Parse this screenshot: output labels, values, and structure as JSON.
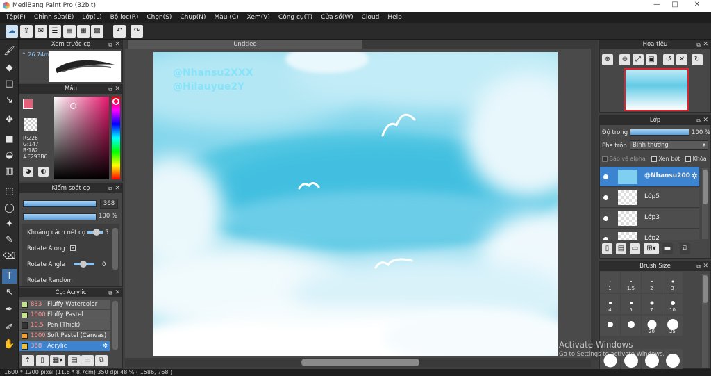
{
  "window": {
    "title": "MediBang Paint Pro (32bit)",
    "minimize": "—",
    "maximize": "□",
    "close": "✕"
  },
  "menu": [
    "Tệp(F)",
    "Chỉnh sửa(E)",
    "Lớp(L)",
    "Bộ lọc(R)",
    "Chọn(S)",
    "Chụp(N)",
    "Màu (C)",
    "Xem(V)",
    "Công cụ(T)",
    "Cửa sổ(W)",
    "Cloud",
    "Help"
  ],
  "toolbar": {
    "undo": "↶",
    "redo": "↷"
  },
  "brush_preview": {
    "title": "Xem trước cọ",
    "size": "26.74mm"
  },
  "color": {
    "title": "Màu",
    "r": "R:226",
    "g": "G:147",
    "b": "B:182",
    "hex": "#E293B6",
    "primary": "#e2607a"
  },
  "brush_control": {
    "title": "Kiểm soát cọ",
    "size": "368",
    "opacity": "100 %",
    "spacing_label": "Khoảng cách nét cọ",
    "spacing_value": "5",
    "rotate_along": "Rotate Along",
    "rotate_angle": "Rotate Angle",
    "rotate_angle_value": "0",
    "rotate_random": "Rotate Random"
  },
  "brushes": {
    "title": "Cọ: Acrylic",
    "items": [
      {
        "size": "833",
        "name": "Fluffy Watercolor",
        "color": "#c6e48a"
      },
      {
        "size": "1000",
        "name": "Fluffy Pastel",
        "color": "#c6e48a"
      },
      {
        "size": "10.5",
        "name": "Pen (Thick)",
        "color": "#333333"
      },
      {
        "size": "1000",
        "name": "Soft Pastel (Canvas)",
        "color": "#f0a030"
      },
      {
        "size": "368",
        "name": "Acrylic",
        "color": "#f0c030"
      }
    ]
  },
  "document": {
    "tab": "Untitled"
  },
  "canvas": {
    "watermark_line1": "@Nhansu2XXX",
    "watermark_line2": "@Hilauyue2Y"
  },
  "navigator": {
    "title": "Hoa tiêu"
  },
  "layers": {
    "title": "Lớp",
    "opacity_label": "Độ trong",
    "opacity_value": "100 %",
    "blend_label": "Pha trộn",
    "blend_value": "Bình thường",
    "protect_alpha": "Bảo vệ alpha",
    "clipping": "Xén bớt",
    "lock": "Khóa",
    "items": [
      "@Nhansu200",
      "Lớp5",
      "Lớp3",
      "Lớp2"
    ]
  },
  "brush_size": {
    "title": "Brush Size",
    "cells": [
      "1",
      "1.5",
      "2",
      "3",
      "4",
      "5",
      "7",
      "10",
      "",
      "",
      "20",
      "25",
      "",
      "",
      "",
      ""
    ]
  },
  "activation": {
    "line1": "Activate Windows",
    "line2": "Go to Settings to activate Windows."
  },
  "status": "1600 * 1200 pixel   (11.6 * 8.7cm)   350 dpi   48 %   ( 1586, 768 )"
}
